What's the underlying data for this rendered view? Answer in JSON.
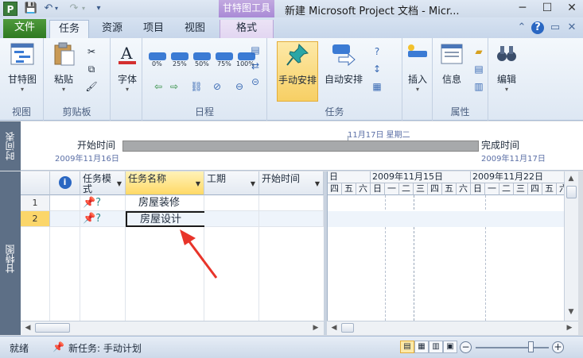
{
  "window": {
    "title": "新建 Microsoft Project 文档 - Micr...",
    "app_icon": "P",
    "context_tab_title": "甘特图工具",
    "minimize": "─",
    "maximize": "☐",
    "close": "✕"
  },
  "tabs": {
    "file": "文件",
    "items": [
      "任务",
      "资源",
      "项目",
      "视图",
      "格式"
    ],
    "active_index": 0
  },
  "ribbon": {
    "view": {
      "button": "甘特图",
      "label": "视图"
    },
    "clipboard": {
      "paste": "粘贴",
      "label": "剪贴板"
    },
    "font": {
      "button": "字体"
    },
    "schedule": {
      "percent": [
        "0%",
        "25%",
        "50%",
        "75%",
        "100%"
      ],
      "label": "日程"
    },
    "tasks": {
      "manual": "手动安排",
      "auto": "自动安排",
      "label": "任务"
    },
    "insert": {
      "button": "插入"
    },
    "properties": {
      "info": "信息",
      "label": "属性"
    },
    "editing": {
      "button": "编辑"
    }
  },
  "timeline": {
    "side_label": "时间表",
    "today": "11月17日 星期二",
    "start_label": "开始时间",
    "start_date": "2009年11月16日",
    "finish_label": "完成时间",
    "finish_date": "2009年11月17日"
  },
  "gantt": {
    "side_label": "甘特图",
    "columns": {
      "info_icon": "i",
      "mode": "任务模式",
      "name": "任务名称",
      "duration": "工期",
      "start": "开始时间"
    },
    "rows": [
      {
        "num": "1",
        "name": "房屋装修"
      },
      {
        "num": "2",
        "name": "房屋设计"
      }
    ],
    "weeks": [
      "日",
      "2009年11月15日",
      "2009年11月22日"
    ],
    "days": [
      "四",
      "五",
      "六",
      "日",
      "一",
      "二",
      "三",
      "四",
      "五",
      "六",
      "日",
      "一",
      "二",
      "三",
      "四",
      "五",
      "六"
    ]
  },
  "status": {
    "ready": "就绪",
    "new_task": "新任务: 手动计划"
  },
  "colors": {
    "file_tab": "#2f7a22",
    "accent": "#f7cf64",
    "arrow": "#e8342a"
  }
}
